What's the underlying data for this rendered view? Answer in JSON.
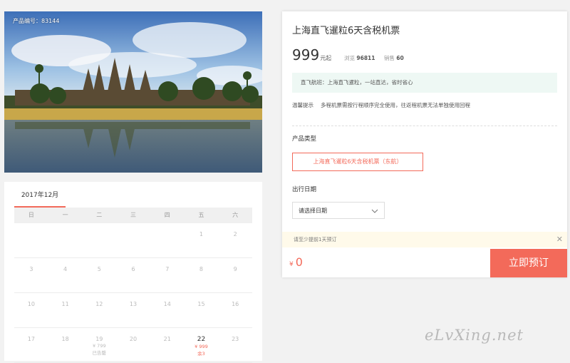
{
  "product": {
    "number_label": "产品编号：83144"
  },
  "panel": {
    "title": "上海直飞暹粒6天含税机票",
    "price": "999",
    "price_unit": "元起",
    "views_label": "浏览",
    "views": "96811",
    "sales_label": "销售",
    "sales": "60",
    "notice": "直飞航班：上海直飞暹粒，一站直达，省时省心",
    "tip_label": "温馨提示",
    "tip_text": "多程机票需按行程顺序完全使用，往返程机票无法单独使用回程",
    "type_label": "产品类型",
    "type_option": "上海直飞暹粒6天含税机票（东航）",
    "date_label": "出行日期",
    "date_placeholder": "请选择日期",
    "warning": "请至少提前1天预订",
    "close": "✕",
    "total_currency": "¥",
    "total": "0",
    "book_button": "立即预订"
  },
  "calendar": {
    "month": "2017年12月",
    "weekdays": [
      "日",
      "一",
      "二",
      "三",
      "四",
      "五",
      "六"
    ],
    "rows": [
      [
        {
          "d": ""
        },
        {
          "d": ""
        },
        {
          "d": ""
        },
        {
          "d": ""
        },
        {
          "d": ""
        },
        {
          "d": "1"
        },
        {
          "d": "2"
        }
      ],
      [
        {
          "d": "3"
        },
        {
          "d": "4"
        },
        {
          "d": "5"
        },
        {
          "d": "6"
        },
        {
          "d": "7"
        },
        {
          "d": "8"
        },
        {
          "d": "9"
        }
      ],
      [
        {
          "d": "10"
        },
        {
          "d": "11"
        },
        {
          "d": "12"
        },
        {
          "d": "13"
        },
        {
          "d": "14"
        },
        {
          "d": "15"
        },
        {
          "d": "16"
        }
      ],
      [
        {
          "d": "17"
        },
        {
          "d": "18"
        },
        {
          "d": "19",
          "p": "¥ 799",
          "s": "已告罄"
        },
        {
          "d": "20"
        },
        {
          "d": "21"
        },
        {
          "d": "22",
          "p": "¥ 999",
          "s": "余3",
          "bold": true
        },
        {
          "d": "23"
        }
      ]
    ]
  },
  "watermark": "eLvXing.net",
  "colors": {
    "accent": "#f36a5a",
    "notice_bg": "#eef8f4",
    "warning_bg": "#fffaea"
  }
}
